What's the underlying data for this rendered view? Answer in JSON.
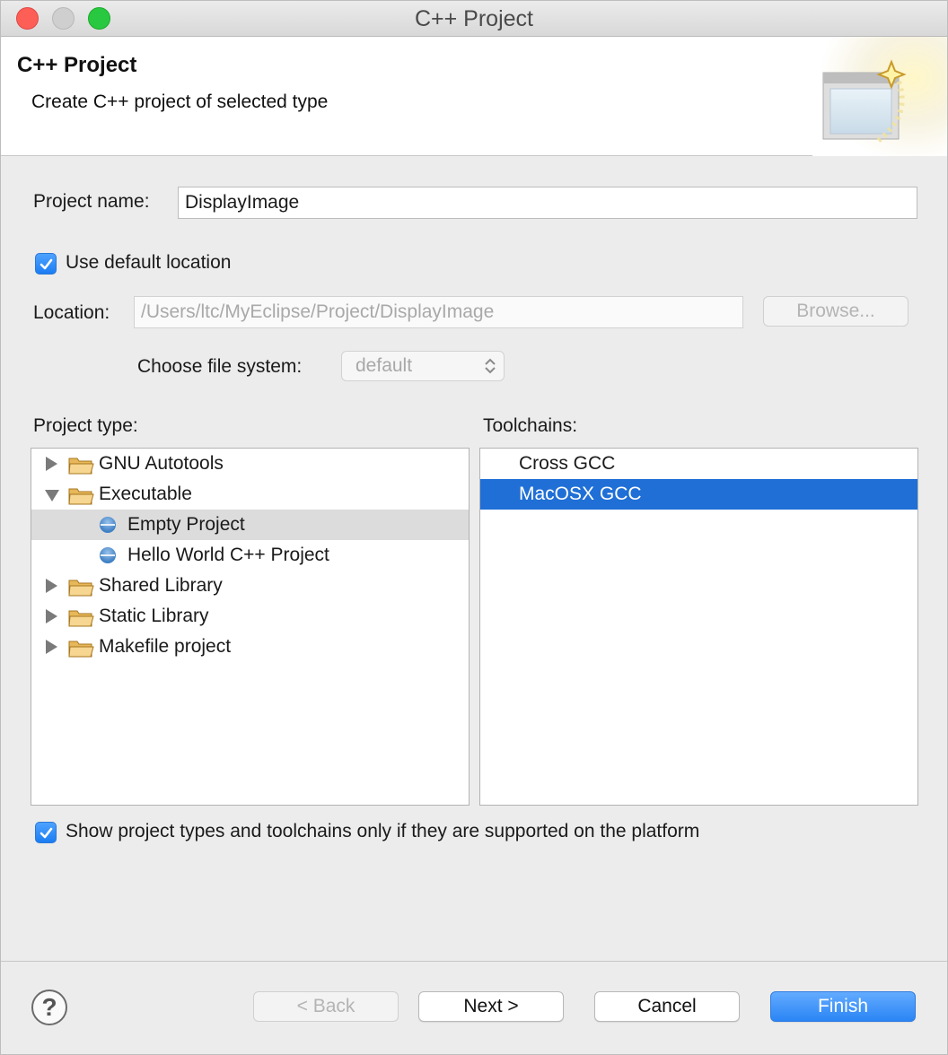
{
  "window": {
    "title": "C++ Project"
  },
  "banner": {
    "title": "C++ Project",
    "description": "Create C++ project of selected type"
  },
  "form": {
    "project_name_label": "Project name:",
    "project_name_value": "DisplayImage",
    "use_default_location_label": "Use default location",
    "use_default_location_checked": true,
    "location_label": "Location:",
    "location_value": "/Users/ltc/MyEclipse/Project/DisplayImage",
    "browse_label": "Browse...",
    "file_system_label": "Choose file system:",
    "file_system_value": "default"
  },
  "project_type": {
    "label": "Project type:",
    "items": [
      {
        "label": "GNU Autotools",
        "kind": "folder",
        "expanded": false
      },
      {
        "label": "Executable",
        "kind": "folder",
        "expanded": true
      },
      {
        "label": "Empty Project",
        "kind": "template",
        "selected": true
      },
      {
        "label": "Hello World C++ Project",
        "kind": "template"
      },
      {
        "label": "Shared Library",
        "kind": "folder",
        "expanded": false
      },
      {
        "label": "Static Library",
        "kind": "folder",
        "expanded": false
      },
      {
        "label": "Makefile project",
        "kind": "folder",
        "expanded": false
      }
    ]
  },
  "toolchains": {
    "label": "Toolchains:",
    "items": [
      {
        "label": "Cross GCC"
      },
      {
        "label": "MacOSX GCC",
        "selected": true
      }
    ]
  },
  "filter": {
    "label": "Show project types and toolchains only if they are supported on the platform",
    "checked": true
  },
  "buttons": {
    "help": "?",
    "back": "< Back",
    "next": "Next >",
    "cancel": "Cancel",
    "finish": "Finish"
  },
  "colors": {
    "accent": "#1f6fd6",
    "primary_button": "#2a85f5",
    "close": "#fd5f57",
    "zoom": "#28c940"
  }
}
